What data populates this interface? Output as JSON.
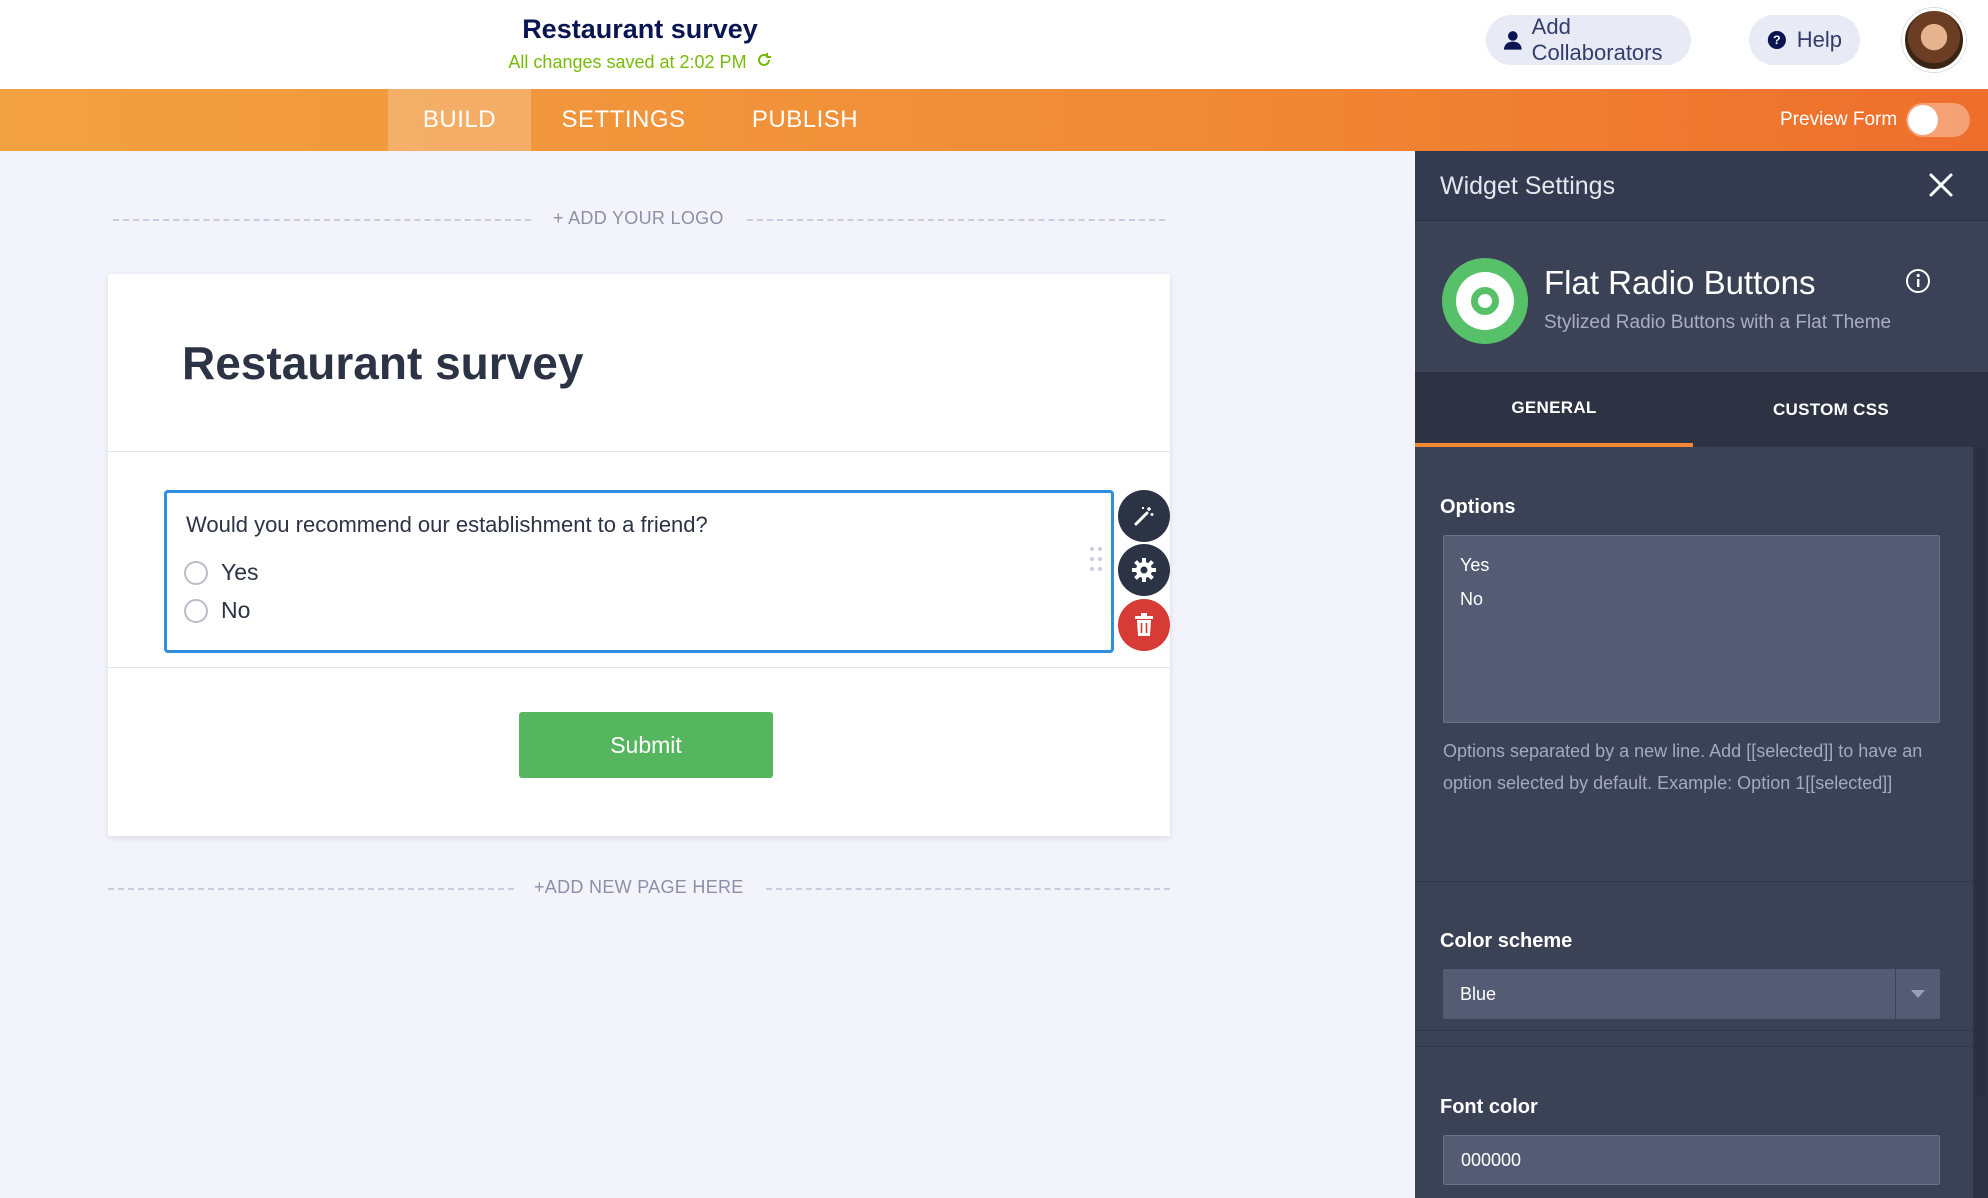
{
  "header": {
    "title": "Restaurant survey",
    "save_status": "All changes saved at 2:02 PM",
    "collaborators_label": "Add Collaborators",
    "help_label": "Help"
  },
  "nav": {
    "tabs": [
      {
        "label": "BUILD",
        "active": true
      },
      {
        "label": "SETTINGS",
        "active": false
      },
      {
        "label": "PUBLISH",
        "active": false
      }
    ],
    "preview_label": "Preview Form",
    "preview_on": false
  },
  "canvas": {
    "add_logo": "+ ADD YOUR LOGO",
    "add_page": "+ADD NEW PAGE HERE"
  },
  "form": {
    "heading": "Restaurant survey",
    "question": {
      "text": "Would you recommend our establishment to a friend?",
      "options": [
        "Yes",
        "No"
      ]
    },
    "submit_label": "Submit"
  },
  "panel": {
    "title": "Widget Settings",
    "widget_name": "Flat Radio Buttons",
    "widget_desc": "Stylized Radio Buttons with a Flat Theme",
    "tabs": [
      {
        "label": "GENERAL",
        "active": true
      },
      {
        "label": "CUSTOM CSS",
        "active": false
      }
    ],
    "options_label": "Options",
    "options_value": "Yes\nNo",
    "options_help": "Options separated by a new line. Add [[selected]] to have an option selected by default. Example: Option 1[[selected]]",
    "color_scheme_label": "Color scheme",
    "color_scheme_value": "Blue",
    "font_color_label": "Font color",
    "font_color_value": "000000"
  },
  "colors": {
    "accent_orange": "#f08a35",
    "submit_green": "#55b65f",
    "selection_blue": "#2f8ee0",
    "delete_red": "#d63b36",
    "panel_bg": "#3c4256"
  }
}
